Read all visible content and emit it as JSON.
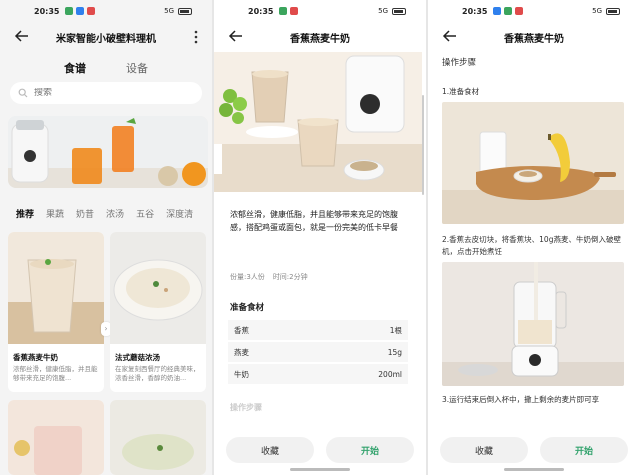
{
  "statusbar": {
    "time": "20:35",
    "signal": "5G"
  },
  "panel1": {
    "title": "米家智能小破壁料理机",
    "tabs": [
      "食谱",
      "设备"
    ],
    "search_placeholder": "搜索",
    "categories": [
      "推荐",
      "果蔬",
      "奶昔",
      "浓汤",
      "五谷",
      "深度清"
    ],
    "cards": [
      {
        "title": "香蕉燕麦牛奶",
        "desc": "浓郁丝滑，健康低脂，并且能够带来充足的饱腹..."
      },
      {
        "title": "法式蘑菇浓汤",
        "desc": "在家复刻西餐厅的经典美味，浓香丝滑，香醇的奶油..."
      }
    ]
  },
  "panel2": {
    "title": "香蕉燕麦牛奶",
    "description": "浓郁丝滑，健康低脂，并且能够带来充足的饱腹感，搭配鸡蛋或面包，就是一份完美的低卡早餐",
    "servings": "份量:3人份",
    "time": "时间:2分钟",
    "ingredients_title": "准备食材",
    "ingredients": [
      {
        "name": "香蕉",
        "amount": "1根"
      },
      {
        "name": "燕麦",
        "amount": "15g"
      },
      {
        "name": "牛奶",
        "amount": "200ml"
      }
    ],
    "steps_peek": "操作步骤",
    "favorite_label": "收藏",
    "start_label": "开始"
  },
  "panel3": {
    "title": "香蕉燕麦牛奶",
    "steps_header": "操作步骤",
    "steps": [
      "1.准备食材",
      "2.香蕉去皮切块，将香蕉块、10g燕麦、牛奶倒入破壁机，点击开始煮饪",
      "3.运行结束后倒入杯中，撒上剩余的麦片即可享"
    ],
    "favorite_label": "收藏",
    "start_label": "开始"
  },
  "colors": {
    "accent_green": "#34a36e",
    "button_bg": "#f1f1f1"
  },
  "icons": [
    "back-icon",
    "more-icon",
    "search-icon"
  ]
}
